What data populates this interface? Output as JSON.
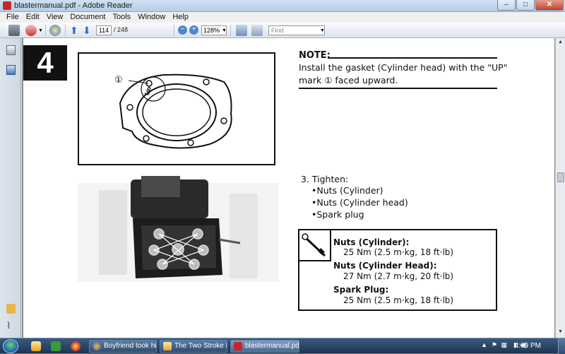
{
  "window": {
    "title": "blastermanual.pdf - Adobe Reader",
    "controls": {
      "minimize": "–",
      "maximize": "□",
      "close": "✕"
    }
  },
  "menu": [
    "File",
    "Edit",
    "View",
    "Document",
    "Tools",
    "Window",
    "Help"
  ],
  "toolbar": {
    "page_number": "114",
    "page_total": "/ 248",
    "zoom": "128%",
    "find_placeholder": "Find"
  },
  "document": {
    "step_number": "4",
    "figure1_label": "①",
    "figure1_mark": "UP",
    "note_heading": "NOTE:",
    "note_line1": "Install the gasket (Cylinder head) with the \"UP\"",
    "note_line2": "mark ① faced upward.",
    "step3_title": "3. Tighten:",
    "bullets": [
      "•Nuts (Cylinder)",
      "•Nuts (Cylinder head)",
      "•Spark plug"
    ],
    "specs": [
      {
        "name": "Nuts (Cylinder):",
        "value": "25 Nm (2.5 m·kg, 18 ft·lb)"
      },
      {
        "name": "Nuts (Cylinder Head):",
        "value": "27 Nm (2.7 m·kg, 20 ft·lb)"
      },
      {
        "name": "Spark Plug:",
        "value": "25 Nm (2.5 m·kg, 18 ft·lb)"
      }
    ]
  },
  "taskbar": {
    "items": [
      {
        "label": "Boyfriend took his Bl...",
        "icon": "firefox-icon"
      },
      {
        "label": "The Two Stroke Files",
        "icon": "folder-icon"
      },
      {
        "label": "blastermanual.pdf - ...",
        "icon": "adobe-reader-icon",
        "active": true
      }
    ],
    "clock": "4:09 PM"
  }
}
